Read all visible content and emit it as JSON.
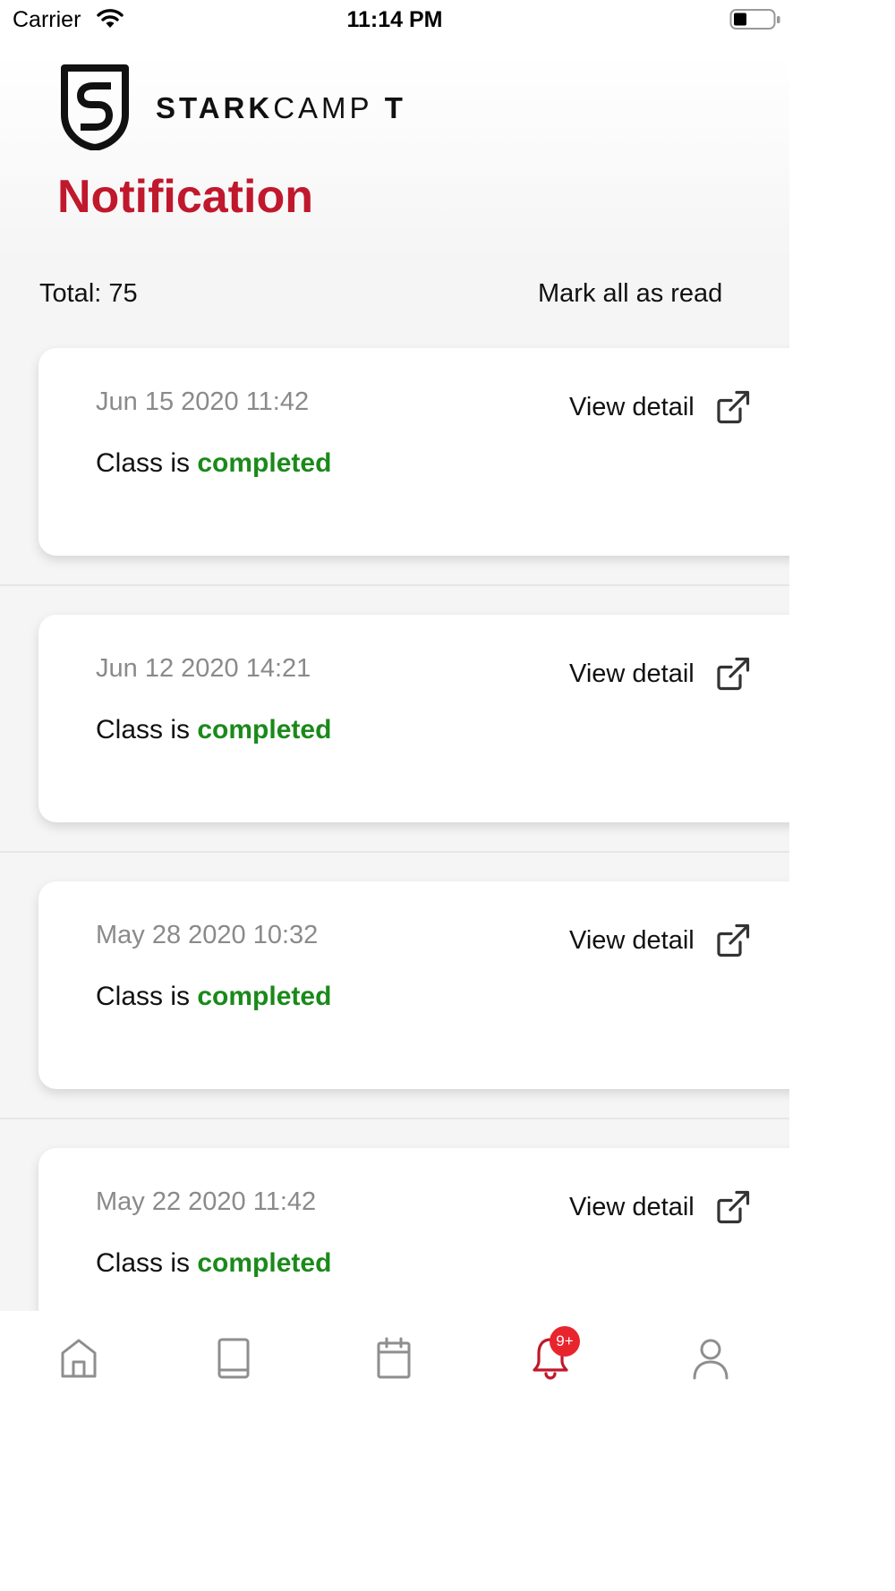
{
  "status_bar": {
    "carrier": "Carrier",
    "time": "11:14 PM"
  },
  "brand": {
    "name_bold": "STARK",
    "name_light": "CAMP",
    "name_suffix": " T"
  },
  "page": {
    "title": "Notification",
    "total_label": "Total: 75",
    "mark_all_label": "Mark all as read"
  },
  "colors": {
    "accent": "#c0182c",
    "completed": "#1a8a1a",
    "badge": "#e8252d"
  },
  "notifications": [
    {
      "date": "Jun 15 2020 11:42",
      "prefix": "Class is ",
      "status": "completed",
      "action": "View detail"
    },
    {
      "date": "Jun 12 2020 14:21",
      "prefix": "Class is ",
      "status": "completed",
      "action": "View detail"
    },
    {
      "date": "May 28 2020 10:32",
      "prefix": "Class is ",
      "status": "completed",
      "action": "View detail"
    },
    {
      "date": "May 22 2020 11:42",
      "prefix": "Class is ",
      "status": "completed",
      "action": "View detail"
    }
  ],
  "tab_bar": {
    "tabs": [
      {
        "icon": "home-icon",
        "active": false
      },
      {
        "icon": "book-icon",
        "active": false
      },
      {
        "icon": "calendar-icon",
        "active": false
      },
      {
        "icon": "bell-icon",
        "active": true
      },
      {
        "icon": "profile-icon",
        "active": false
      }
    ],
    "badge": "9+"
  }
}
